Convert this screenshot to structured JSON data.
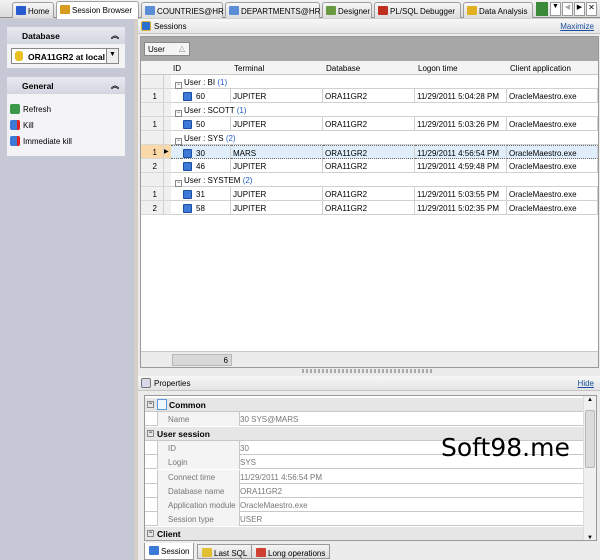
{
  "tabs": [
    {
      "label": "Home",
      "icon": "home-icon",
      "color": "#2a5ad0"
    },
    {
      "label": "Session Browser",
      "icon": "session-browser-icon",
      "color": "#d89b20",
      "active": true
    },
    {
      "label": "COUNTRIES@HR",
      "icon": "table-icon",
      "color": "#5b8ed8"
    },
    {
      "label": "DEPARTMENTS@HR",
      "icon": "table-icon",
      "color": "#5b8ed8"
    },
    {
      "label": "Designer",
      "icon": "designer-icon",
      "color": "#6a9a40"
    },
    {
      "label": "PL/SQL Debugger",
      "icon": "bug-icon",
      "color": "#c03020"
    },
    {
      "label": "Data Analysis",
      "icon": "database-icon",
      "color": "#e0b020"
    }
  ],
  "sidebar": {
    "database_title": "Database",
    "database_value": "ORA11GR2 at local",
    "general_title": "General",
    "actions": [
      {
        "label": "Refresh",
        "icon": "refresh-icon"
      },
      {
        "label": "Kill",
        "icon": "kill-icon"
      },
      {
        "label": "Immediate kill",
        "icon": "immediate-kill-icon"
      }
    ]
  },
  "sessions": {
    "title": "Sessions",
    "maximize": "Maximize",
    "group_by": "User",
    "columns": [
      "ID",
      "Terminal",
      "Database",
      "Logon time",
      "Client application"
    ],
    "groups": [
      {
        "label": "User : BI",
        "count": "(1)",
        "rows": [
          {
            "n": "1",
            "id": "60",
            "terminal": "JUPITER",
            "db": "ORA11GR2",
            "logon": "11/29/2011 5:04:28 PM",
            "client": "OracleMaestro.exe"
          }
        ]
      },
      {
        "label": "User : SCOTT",
        "count": "(1)",
        "rows": [
          {
            "n": "1",
            "id": "50",
            "terminal": "JUPITER",
            "db": "ORA11GR2",
            "logon": "11/29/2011 5:03:26 PM",
            "client": "OracleMaestro.exe"
          }
        ]
      },
      {
        "label": "User : SYS",
        "count": "(2)",
        "rows": [
          {
            "n": "1",
            "id": "30",
            "terminal": "MARS",
            "db": "ORA11GR2",
            "logon": "11/29/2011 4:56:54 PM",
            "client": "OracleMaestro.exe",
            "selected": true
          },
          {
            "n": "2",
            "id": "46",
            "terminal": "JUPITER",
            "db": "ORA11GR2",
            "logon": "11/29/2011 4:59:48 PM",
            "client": "OracleMaestro.exe"
          }
        ]
      },
      {
        "label": "User : SYSTEM",
        "count": "(2)",
        "rows": [
          {
            "n": "1",
            "id": "31",
            "terminal": "JUPITER",
            "db": "ORA11GR2",
            "logon": "11/29/2011 5:03:55 PM",
            "client": "OracleMaestro.exe"
          },
          {
            "n": "2",
            "id": "58",
            "terminal": "JUPITER",
            "db": "ORA11GR2",
            "logon": "11/29/2011 5:02:35 PM",
            "client": "OracleMaestro.exe"
          }
        ]
      }
    ],
    "footer_count": "6"
  },
  "properties": {
    "title": "Properties",
    "hide": "Hide",
    "items": [
      {
        "cat": "Common"
      },
      {
        "k": "Name",
        "v": "30 SYS@MARS"
      },
      {
        "cat": "User session"
      },
      {
        "k": "ID",
        "v": "30"
      },
      {
        "k": "Login",
        "v": "SYS"
      },
      {
        "k": "Connect time",
        "v": "11/29/2011 4:56:54 PM"
      },
      {
        "k": "Database name",
        "v": "ORA11GR2"
      },
      {
        "k": "Application module",
        "v": "OracleMaestro.exe"
      },
      {
        "k": "Session type",
        "v": "USER"
      },
      {
        "cat": "Client"
      }
    ]
  },
  "watermark": "Soft98.me",
  "bottom_tabs": [
    {
      "label": "Session",
      "active": true
    },
    {
      "label": "Last SQL"
    },
    {
      "label": "Long operations"
    }
  ]
}
